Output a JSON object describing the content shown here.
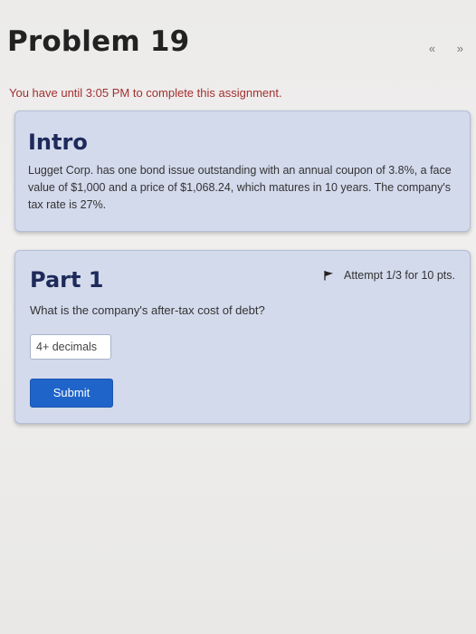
{
  "page": {
    "title": "Problem 19",
    "nav_arrows": "« »",
    "deadline_text": "You have until 3:05 PM to complete this assignment."
  },
  "intro": {
    "title": "Intro",
    "text": "Lugget Corp. has one bond issue outstanding with an annual coupon of 3.8%, a face value of $1,000 and a price of $1,068.24, which matures in 10 years. The company's tax rate is 27%."
  },
  "part": {
    "title": "Part 1",
    "attempt_text": "Attempt 1/3 for 10 pts.",
    "attempt_icon": "flag-icon",
    "question": "What is the company's after-tax cost of debt?",
    "answer_value": "",
    "answer_placeholder": "4+ decimals",
    "submit_label": "Submit"
  }
}
